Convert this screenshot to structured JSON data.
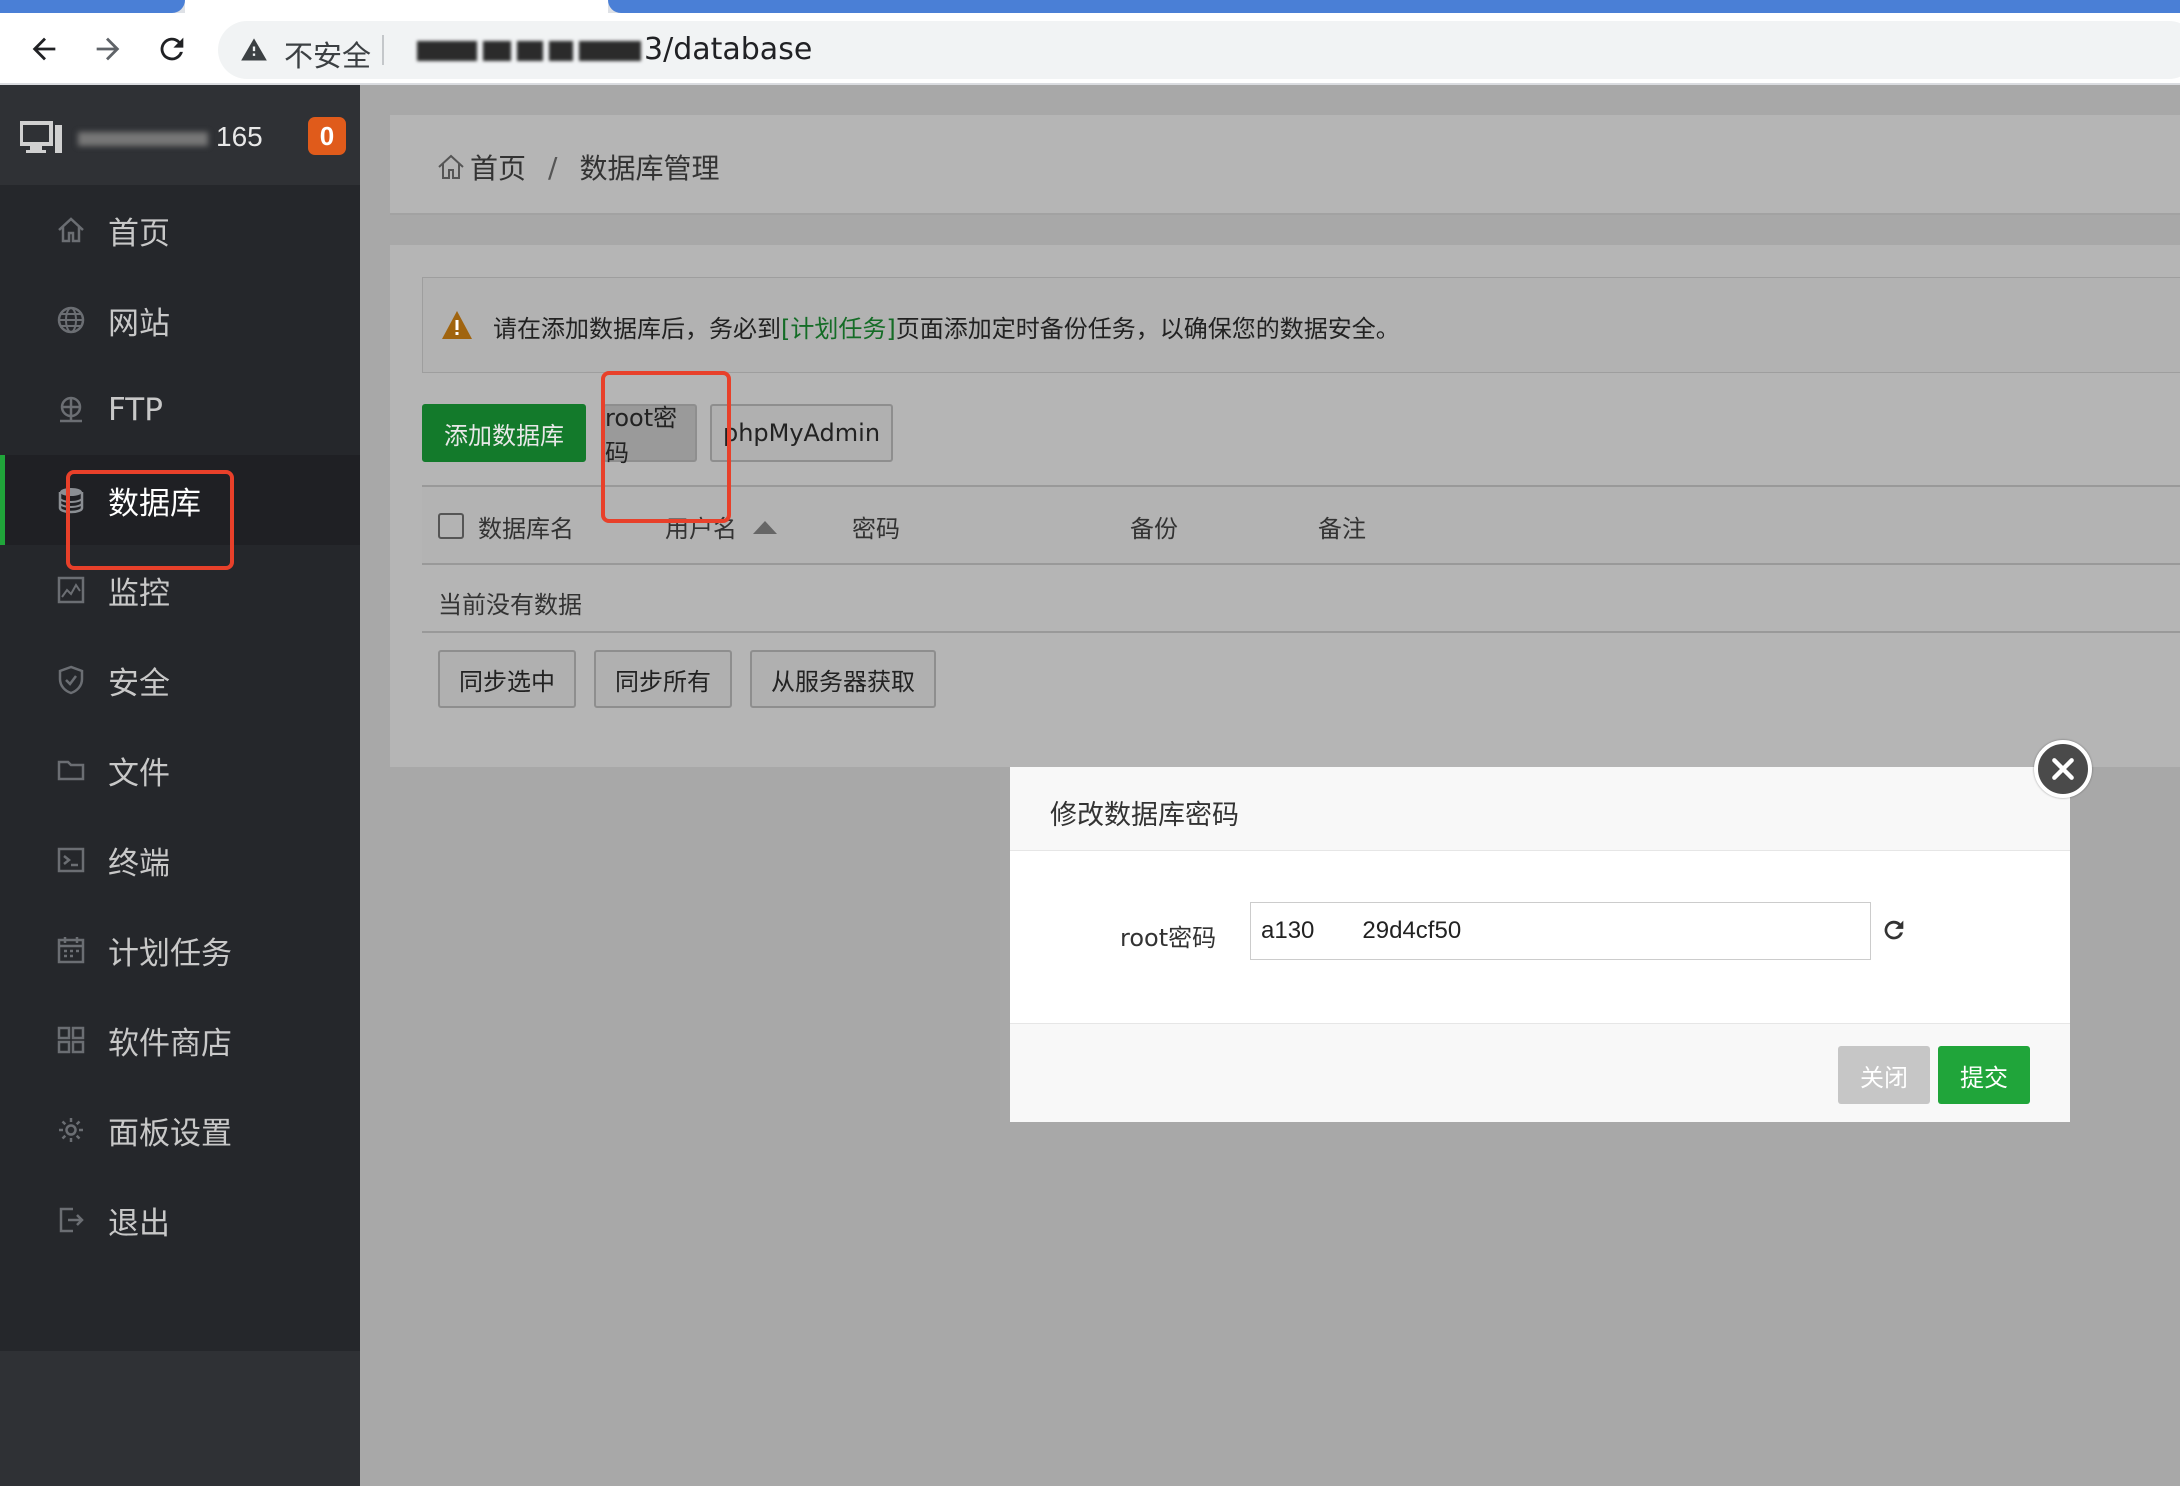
{
  "browser": {
    "security_label": "不安全",
    "url_path": "3/database"
  },
  "sidebar": {
    "server_ip_suffix": "165",
    "notification_count": "0",
    "items": [
      {
        "label": "首页",
        "icon": "home-icon"
      },
      {
        "label": "网站",
        "icon": "globe-icon"
      },
      {
        "label": "FTP",
        "icon": "ftp-icon"
      },
      {
        "label": "数据库",
        "icon": "database-icon"
      },
      {
        "label": "监控",
        "icon": "monitor-icon"
      },
      {
        "label": "安全",
        "icon": "shield-icon"
      },
      {
        "label": "文件",
        "icon": "folder-icon"
      },
      {
        "label": "终端",
        "icon": "terminal-icon"
      },
      {
        "label": "计划任务",
        "icon": "calendar-icon"
      },
      {
        "label": "软件商店",
        "icon": "apps-icon"
      },
      {
        "label": "面板设置",
        "icon": "gear-icon"
      },
      {
        "label": "退出",
        "icon": "logout-icon"
      }
    ],
    "active_index": 3
  },
  "breadcrumb": {
    "home": "首页",
    "separator": "/",
    "current": "数据库管理"
  },
  "alert": {
    "text_before": "请在添加数据库后，务必到",
    "link": "[计划任务]",
    "text_after": "页面添加定时备份任务，以确保您的数据安全。"
  },
  "toolbar": {
    "add_db": "添加数据库",
    "root_pwd": "root密码",
    "phpmyadmin": "phpMyAdmin"
  },
  "table": {
    "headers": [
      "数据库名",
      "用户名",
      "密码",
      "备份",
      "备注"
    ],
    "empty": "当前没有数据"
  },
  "actions": {
    "sync_selected": "同步选中",
    "sync_all": "同步所有",
    "fetch_from_server": "从服务器获取"
  },
  "modal": {
    "title": "修改数据库密码",
    "field_label": "root密码",
    "field_value": "a130      29d4cf50",
    "close": "关闭",
    "submit": "提交"
  },
  "colors": {
    "accent_green": "#20a53a",
    "badge_orange": "#e05b1b",
    "highlight_red": "#e8402a"
  }
}
